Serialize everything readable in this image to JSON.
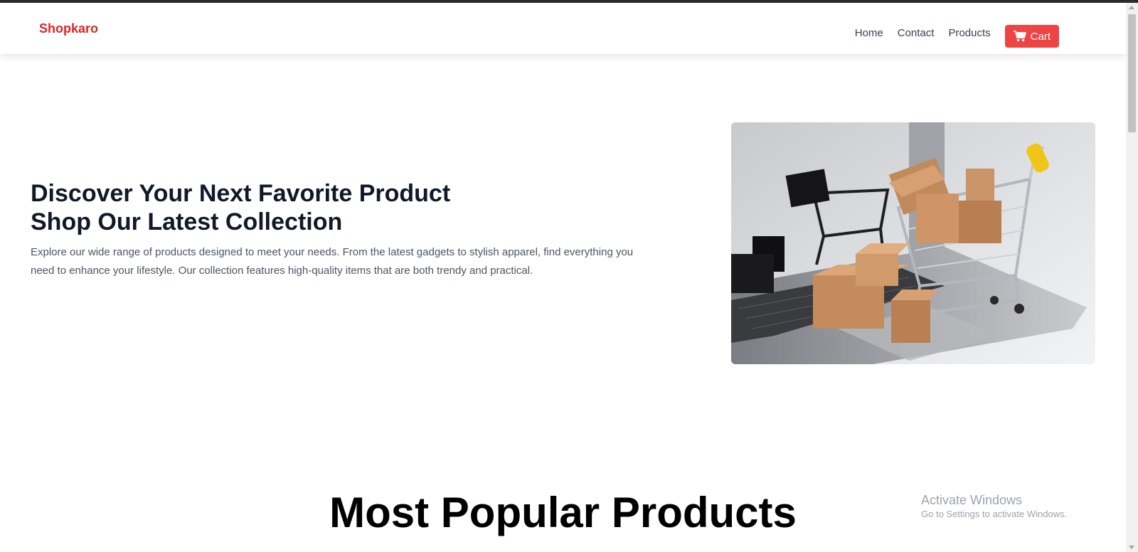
{
  "navbar": {
    "brand": "Shopkaro",
    "links": [
      "Home",
      "Contact",
      "Products"
    ],
    "cart_label": "Cart",
    "cart_icon": "shopping-cart-icon",
    "brand_color": "#dc2626",
    "cart_button_color": "#ef4444"
  },
  "hero": {
    "title_line1": "Discover Your Next Favorite Product",
    "title_line2": "Shop Our Latest Collection",
    "description": "Explore our wide range of products designed to meet your needs. From the latest gadgets to stylish apparel, find everything you need to enhance your lifestyle. Our collection features high-quality items that are both trendy and practical."
  },
  "section": {
    "title": "Most Popular Products"
  },
  "watermark": {
    "line1": "Activate Windows",
    "line2": "Go to Settings to activate Windows."
  }
}
